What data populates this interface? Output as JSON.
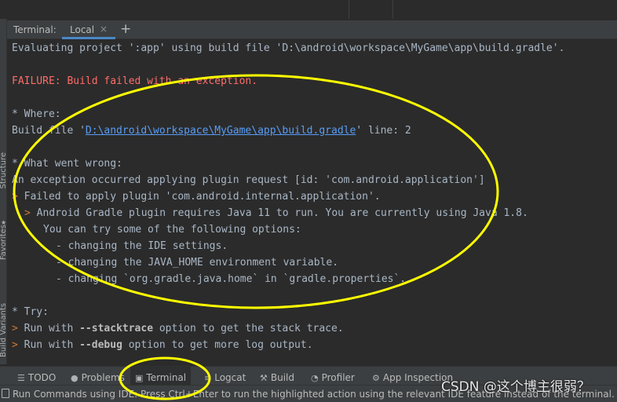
{
  "terminal": {
    "title": "Terminal:",
    "tab_label": "Local",
    "tab_close": "×",
    "new_tab": "+"
  },
  "left_stripe": {
    "structure": "Structure",
    "favorites": "Favorites",
    "build_variants": "Build Variants"
  },
  "output": {
    "l1": "Evaluating project ':app' using build file 'D:\\android\\workspace\\MyGame\\app\\build.gradle'.",
    "l2": "FAILURE: Build failed with an exception.",
    "l3": "* Where:",
    "l4_pre": "Build file '",
    "l4_link": "D:\\android\\workspace\\MyGame\\app\\build.gradle",
    "l4_post": "' line: 2",
    "l5": "* What went wrong:",
    "l6": "An exception occurred applying plugin request [id: 'com.android.application']",
    "l7_arrow": ">",
    "l7": " Failed to apply plugin 'com.android.internal.application'.",
    "l8_arrow": ">",
    "l8": " Android Gradle plugin requires Java 11 to run. You are currently using Java 1.8.",
    "l9": "You can try some of the following options:",
    "l10": "- changing the IDE settings.",
    "l11": "- changing the JAVA_HOME environment variable.",
    "l12": "- changing `org.gradle.java.home` in `gradle.properties`.",
    "l13": "* Try:",
    "l14_arrow": ">",
    "l14_a": " Run with ",
    "l14_b": "--stacktrace",
    "l14_c": " option to get the stack trace.",
    "l15_arrow": ">",
    "l15_a": " Run with ",
    "l15_b": "--debug",
    "l15_c": " option to get more log output."
  },
  "toolbar": {
    "todo": "TODO",
    "problems": "Problems",
    "terminal": "Terminal",
    "logcat": "Logcat",
    "build": "Build",
    "profiler": "Profiler",
    "app_inspection": "App Inspection"
  },
  "status": {
    "text": "Run Commands using IDE: Press Ctrl+Enter to run the highlighted action using the relevant IDE feature instead of the terminal. Press"
  },
  "watermark": "CSDN @这个博主很弱？",
  "colors": {
    "background": "#2b2b2b",
    "panel": "#3c3f41",
    "text": "#a9b7c6",
    "error": "#ff6b68",
    "link": "#589df6",
    "accent": "#4a88c7",
    "annotation": "#ffff00"
  },
  "icons": {
    "todo": "list-icon",
    "problems": "info-icon",
    "terminal": "terminal-icon",
    "logcat": "logcat-icon",
    "build": "hammer-icon",
    "profiler": "gauge-icon",
    "app_inspection": "inspect-icon"
  }
}
